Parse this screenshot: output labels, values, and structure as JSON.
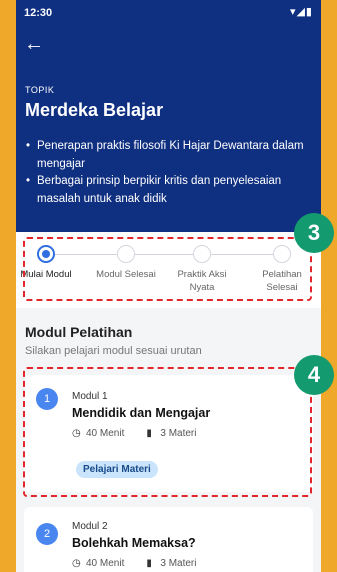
{
  "status_bar": {
    "time": "12:30",
    "icons": "▾◢▮"
  },
  "header": {
    "back_icon": "←",
    "topic_label": "TOPIK",
    "title": "Merdeka Belajar",
    "bullets": [
      "Penerapan praktis filosofi Ki Hajar Dewantara dalam mengajar",
      "Berbagai prinsip berpikir kritis dan penyelesaian masalah untuk anak didik"
    ]
  },
  "progress": {
    "steps": [
      {
        "label": "Mulai Modul",
        "active": true
      },
      {
        "label": "Modul Selesai",
        "active": false
      },
      {
        "label": "Praktik Aksi Nyata",
        "active": false
      },
      {
        "label": "Pelatihan Selesai",
        "active": false
      }
    ],
    "accent": "#2f6fe0"
  },
  "section": {
    "title": "Modul Pelatihan",
    "subtitle": "Silakan pelajari modul sesuai urutan"
  },
  "modules": [
    {
      "number": "1",
      "label": "Modul 1",
      "title": "Mendidik dan Mengajar",
      "duration": "40 Menit",
      "materials": "3 Materi",
      "button": "Pelajari Materi"
    },
    {
      "number": "2",
      "label": "Modul 2",
      "title": "Bolehkah Memaksa?",
      "duration": "40 Menit",
      "materials": "3 Materi"
    }
  ],
  "annotations": {
    "badge_3": "3",
    "badge_4": "4",
    "badge_color": "#149a6f",
    "dash_color": "#e1262c"
  }
}
